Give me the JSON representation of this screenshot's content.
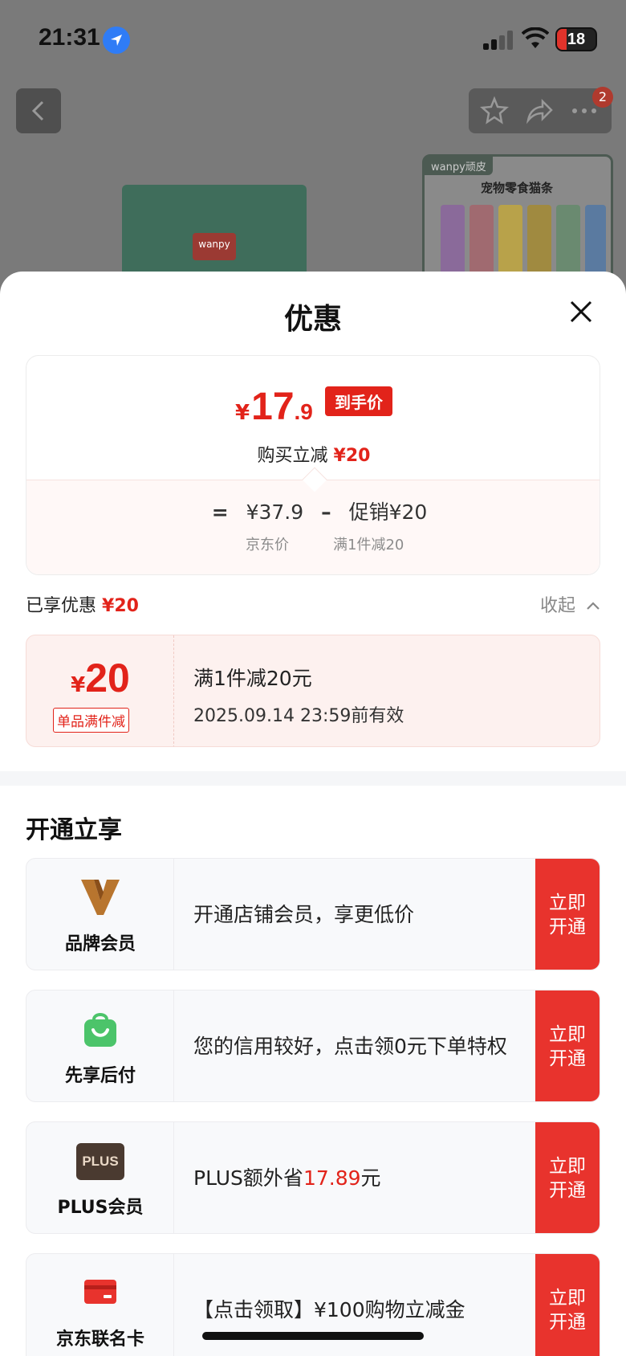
{
  "status_bar": {
    "time": "21:31",
    "battery": "18"
  },
  "background": {
    "side_card_brand": "wanpy顽皮",
    "side_card_title": "宠物零食猫条",
    "product_logo": "wanpy",
    "cart_badge": "2"
  },
  "sheet": {
    "title": "优惠",
    "price": {
      "currency": "¥",
      "integer": "17",
      "decimal": ".9",
      "badge": "到手价",
      "reduce_label": "购买立减",
      "reduce_amount": "¥20",
      "formula_eq": "=",
      "jd_price": "¥37.9",
      "formula_minus": "–",
      "promo": "促销¥20",
      "jd_price_label": "京东价",
      "promo_label": "满1件减20"
    },
    "enjoyed": {
      "label": "已享优惠",
      "amount": "¥20",
      "collapse": "收起"
    },
    "coupon": {
      "currency": "¥",
      "amount": "20",
      "tag": "单品满件减",
      "title": "满1件减20元",
      "validity": "2025.09.14 23:59前有效"
    },
    "section_title": "开通立享",
    "benefits": [
      {
        "name": "品牌会员",
        "desc": "开通店铺会员，享更低价",
        "btn": "立即开通",
        "icon": "brand-v-icon"
      },
      {
        "name": "先享后付",
        "desc": "您的信用较好，点击领0元下单特权",
        "btn": "立即开通",
        "icon": "shopping-bag-icon"
      },
      {
        "name": "PLUS会员",
        "desc_prefix": "PLUS额外省",
        "desc_amount": "17.89",
        "desc_suffix": "元",
        "btn": "立即开通",
        "icon": "plus-logo",
        "logo_text": "PLUS"
      },
      {
        "name": "京东联名卡",
        "desc": "【点击领取】¥100购物立减金",
        "btn": "立即开通",
        "icon": "card-icon"
      }
    ]
  },
  "colors": {
    "accent": "#e2231a",
    "button": "#e8332d",
    "green": "#4cc46a"
  }
}
